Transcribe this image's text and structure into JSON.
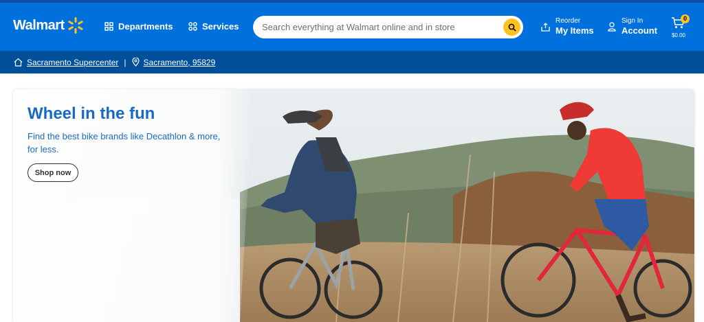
{
  "brand": {
    "name": "Walmart",
    "accent": "#0071dc",
    "spark_color": "#ffc220"
  },
  "nav": {
    "departments": "Departments",
    "services": "Services"
  },
  "search": {
    "placeholder": "Search everything at Walmart online and in store"
  },
  "reorder": {
    "small": "Reorder",
    "big": "My Items"
  },
  "account": {
    "small": "Sign In",
    "big": "Account"
  },
  "cart": {
    "count": "0",
    "total": "$0.00"
  },
  "location": {
    "store": "Sacramento Supercenter",
    "separator": "|",
    "zip": "Sacramento, 95829"
  },
  "hero": {
    "title": "Wheel in the fun",
    "subtitle": "Find the best bike brands like Decathlon & more, for less.",
    "cta": "Shop now"
  }
}
